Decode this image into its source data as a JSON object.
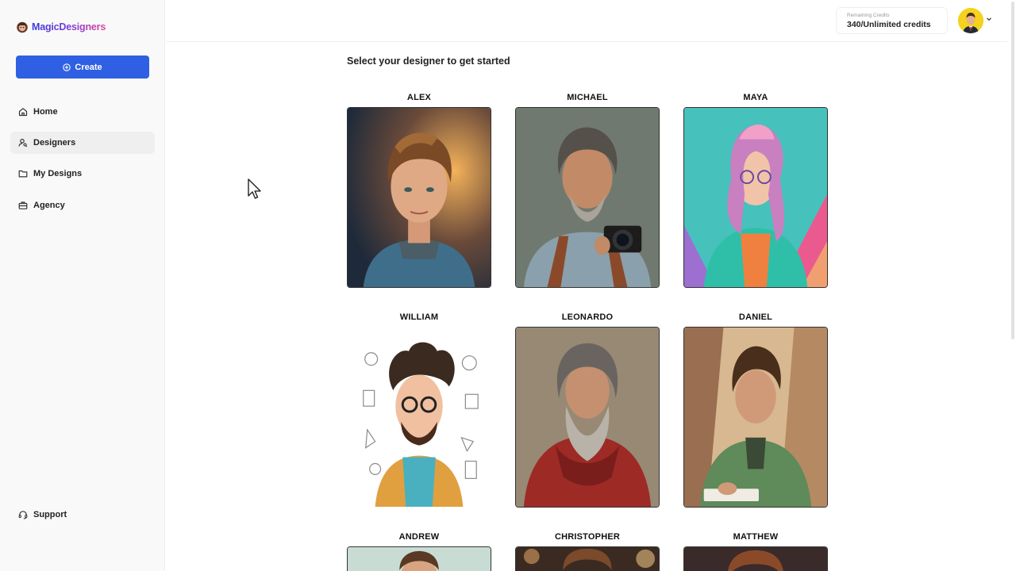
{
  "app": {
    "logo_text": "MagicDesigners"
  },
  "sidebar": {
    "create_label": "Create",
    "items": [
      {
        "label": "Home",
        "icon": "home-icon",
        "active": false
      },
      {
        "label": "Designers",
        "icon": "user-search-icon",
        "active": true
      },
      {
        "label": "My Designs",
        "icon": "folder-icon",
        "active": false
      },
      {
        "label": "Agency",
        "icon": "briefcase-icon",
        "active": false
      }
    ],
    "support_label": "Support"
  },
  "header": {
    "credits_label": "Remaining Credits",
    "credits_value": "340/Unlimited credits"
  },
  "main": {
    "title": "Select your designer to get started",
    "designers": [
      {
        "name": "ALEX"
      },
      {
        "name": "MICHAEL"
      },
      {
        "name": "MAYA"
      },
      {
        "name": "WILLIAM"
      },
      {
        "name": "LEONARDO"
      },
      {
        "name": "DANIEL"
      },
      {
        "name": "ANDREW"
      },
      {
        "name": "CHRISTOPHER"
      },
      {
        "name": "MATTHEW"
      }
    ]
  },
  "colors": {
    "accent": "#2f5fe3",
    "sidebar_bg": "#f9f9f9",
    "active_bg": "#efefef"
  }
}
